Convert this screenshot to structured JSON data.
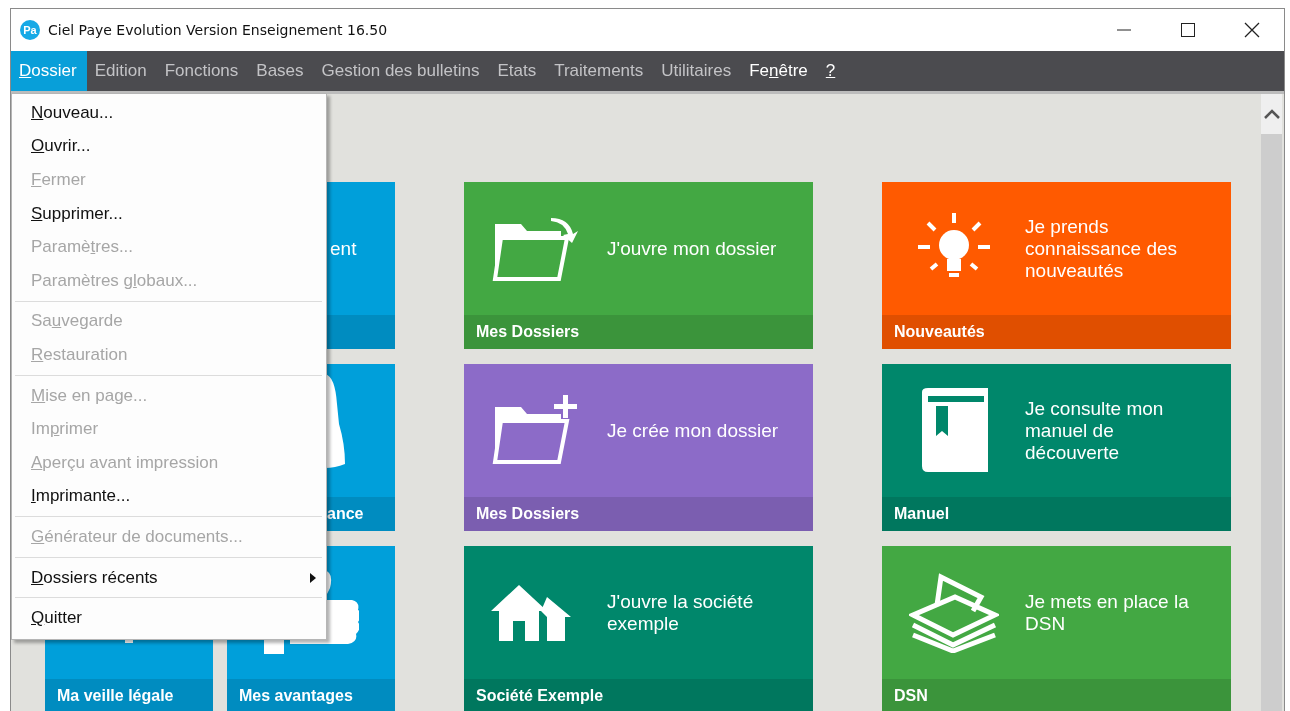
{
  "window": {
    "title": "Ciel Paye Evolution Version Enseignement 16.50",
    "app_badge": "Pa"
  },
  "menu_bar": [
    {
      "key": "D",
      "post": "ossier",
      "selected": true,
      "disabled": false
    },
    {
      "pre": "Edition",
      "selected": false,
      "disabled": true
    },
    {
      "pre": "Fonctions",
      "selected": false,
      "disabled": true
    },
    {
      "pre": "Bases",
      "selected": false,
      "disabled": true
    },
    {
      "pre": "Gestion des bulletins",
      "selected": false,
      "disabled": true
    },
    {
      "pre": "Etats",
      "selected": false,
      "disabled": true
    },
    {
      "pre": "Traitements",
      "selected": false,
      "disabled": true
    },
    {
      "pre": "Utilitaires",
      "selected": false,
      "disabled": true
    },
    {
      "pre": "Fe",
      "key": "n",
      "post": "être",
      "selected": false,
      "disabled": false
    },
    {
      "key": "?",
      "selected": false,
      "disabled": false
    }
  ],
  "dropdown": {
    "groups": [
      [
        {
          "kind": "command",
          "key": "N",
          "post": "ouveau...",
          "disabled": false
        },
        {
          "kind": "command",
          "key": "O",
          "post": "uvrir...",
          "disabled": false
        },
        {
          "kind": "command",
          "key": "F",
          "post": "ermer",
          "disabled": true
        },
        {
          "kind": "command",
          "key": "S",
          "post": "upprimer...",
          "disabled": false
        },
        {
          "kind": "command",
          "pre": "Paramè",
          "key": "t",
          "post": "res...",
          "disabled": true
        },
        {
          "kind": "command",
          "pre": "Paramètres g",
          "key": "l",
          "post": "obaux...",
          "disabled": true
        }
      ],
      [
        {
          "kind": "command",
          "pre": "Sa",
          "key": "u",
          "post": "vegarde",
          "disabled": true
        },
        {
          "kind": "command",
          "key": "R",
          "post": "estauration",
          "disabled": true
        }
      ],
      [
        {
          "kind": "command",
          "key": "M",
          "post": "ise en page...",
          "disabled": true
        },
        {
          "kind": "command",
          "pre": "Im",
          "key": "p",
          "post": "rimer",
          "disabled": true
        },
        {
          "kind": "command",
          "key": "A",
          "post": "perçu avant impression",
          "disabled": true
        },
        {
          "kind": "command",
          "key": "I",
          "post": "mprimante...",
          "disabled": false
        }
      ],
      [
        {
          "kind": "command",
          "key": "G",
          "post": "énérateur de documents...",
          "disabled": true
        }
      ],
      [
        {
          "kind": "submenu",
          "key": "D",
          "post": "ossiers récents",
          "disabled": false
        }
      ],
      [
        {
          "kind": "command",
          "key": "Q",
          "post": "uitter",
          "disabled": false
        }
      ]
    ]
  },
  "tile_rows": [
    {
      "tiles": [
        {
          "kind": "wide",
          "text": "ent",
          "color": "#009fda"
        },
        {
          "kind": "regular",
          "text": "J'ouvre mon dossier",
          "label": "Mes Dossiers",
          "color": "#43a843"
        },
        {
          "kind": "regular",
          "text": "Je prends connaissance des nouveautés",
          "label": "Nouveautés",
          "color": "#ff5a00"
        }
      ]
    },
    {
      "tiles": [
        {
          "kind": "wide",
          "label": "ance",
          "color": "#009fda"
        },
        {
          "kind": "regular",
          "text": "Je crée mon dossier",
          "label": "Mes Dossiers",
          "color": "#8c6bc8"
        },
        {
          "kind": "regular",
          "text": "Je consulte mon manuel de découverte",
          "label": "Manuel",
          "color": "#00876b"
        }
      ]
    },
    {
      "tiles": [
        {
          "kind": "small",
          "label": "Ma veille légale",
          "color": "#009fda"
        },
        {
          "kind": "small",
          "label": "Mes avantages",
          "color": "#009fda"
        },
        {
          "kind": "regular",
          "text": "J'ouvre la société exemple",
          "label": "Société Exemple",
          "color": "#00876b"
        },
        {
          "kind": "regular",
          "text": "Je mets en place la DSN",
          "label": "DSN",
          "color": "#43a843"
        }
      ]
    }
  ]
}
